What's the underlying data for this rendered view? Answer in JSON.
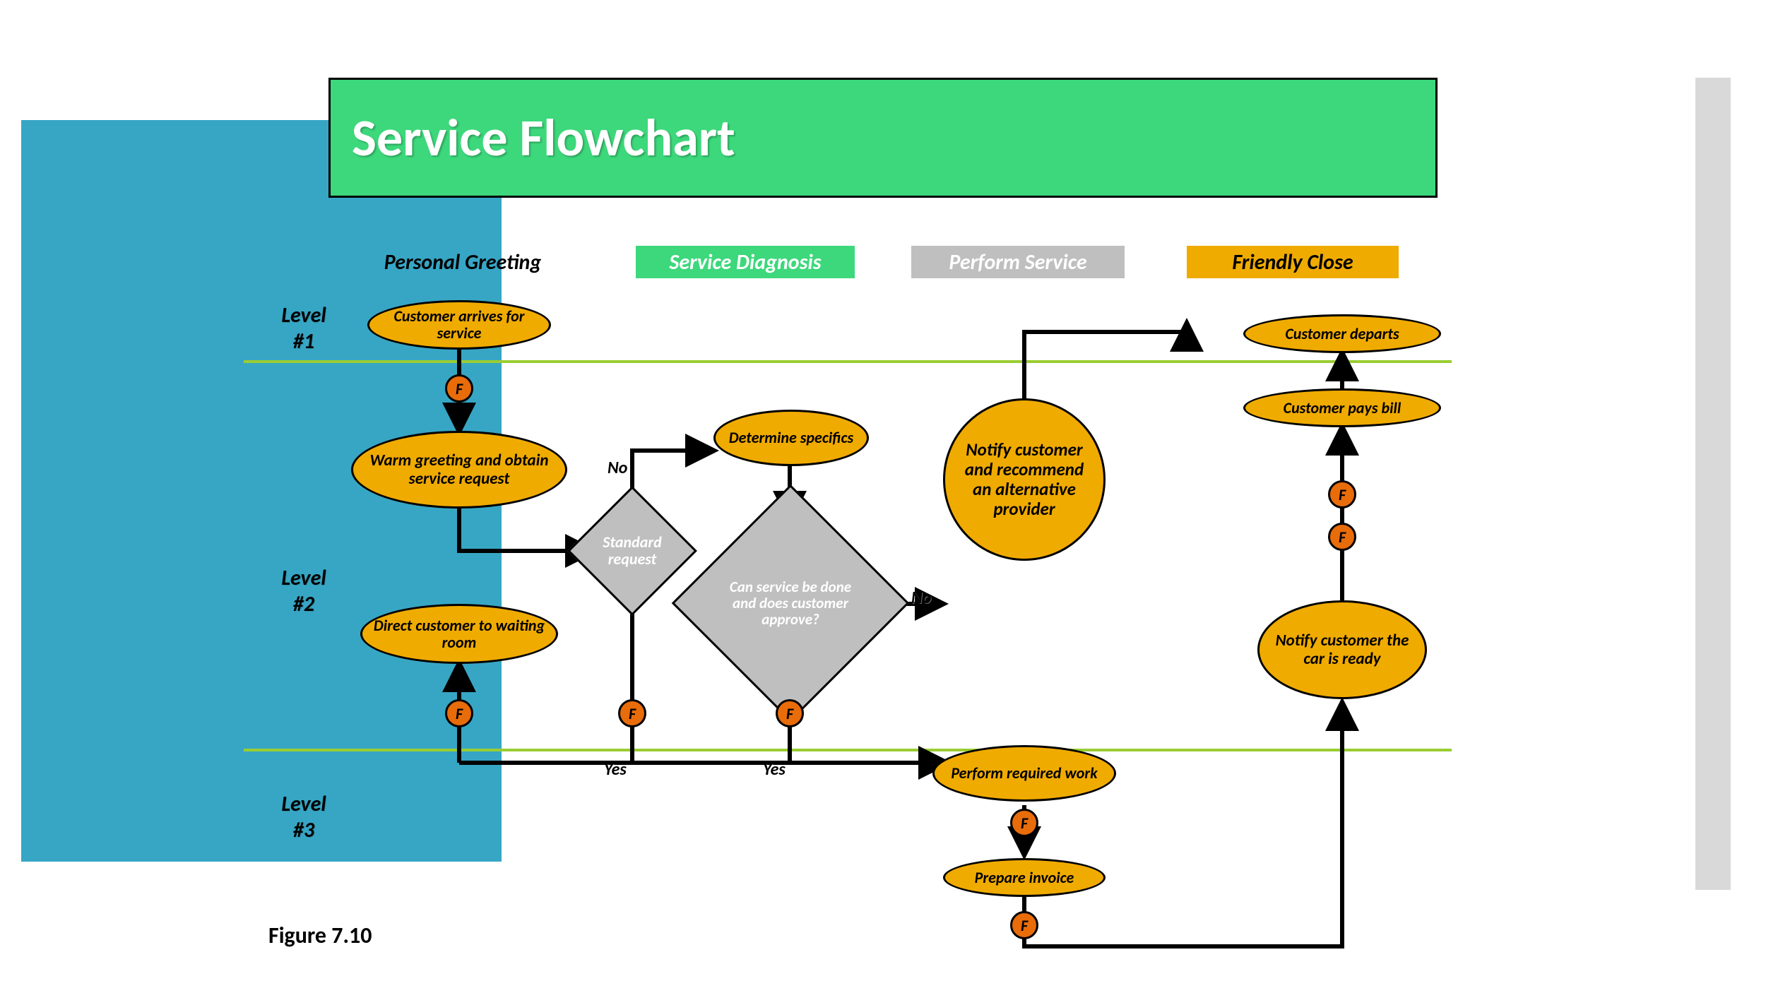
{
  "title": "Service Flowchart",
  "columns": {
    "pg": "Personal Greeting",
    "sd": "Service Diagnosis",
    "ps": "Perform Service",
    "fc": "Friendly Close"
  },
  "levels": {
    "l1a": "Level",
    "l1b": "#1",
    "l2a": "Level",
    "l2b": "#2",
    "l3a": "Level",
    "l3b": "#3"
  },
  "nodes": {
    "n_arrive": "Customer arrives for service",
    "n_greet": "Warm greeting and obtain service request",
    "n_direct": "Direct customer to waiting room",
    "n_spec": "Determine specifics",
    "n_notify_alt": "Notify customer and recommend an alternative provider",
    "n_perform": "Perform required work",
    "n_invoice": "Prepare invoice",
    "n_ready": "Notify customer the car is ready",
    "n_pays": "Customer pays bill",
    "n_departs": "Customer departs"
  },
  "decisions": {
    "d_standard": "Standard request",
    "d_approve": "Can service be done and does customer approve?"
  },
  "labels": {
    "no1": "No",
    "no2": "No",
    "yes1": "Yes",
    "yes2": "Yes"
  },
  "fmark": "F",
  "caption": "Figure 7.10",
  "colors": {
    "green": "#3CD87B",
    "blue": "#37A6C5",
    "amber": "#F0AB00",
    "orange": "#E86C0A",
    "gray": "#BFBFBF",
    "olive": "#9ACD32"
  }
}
